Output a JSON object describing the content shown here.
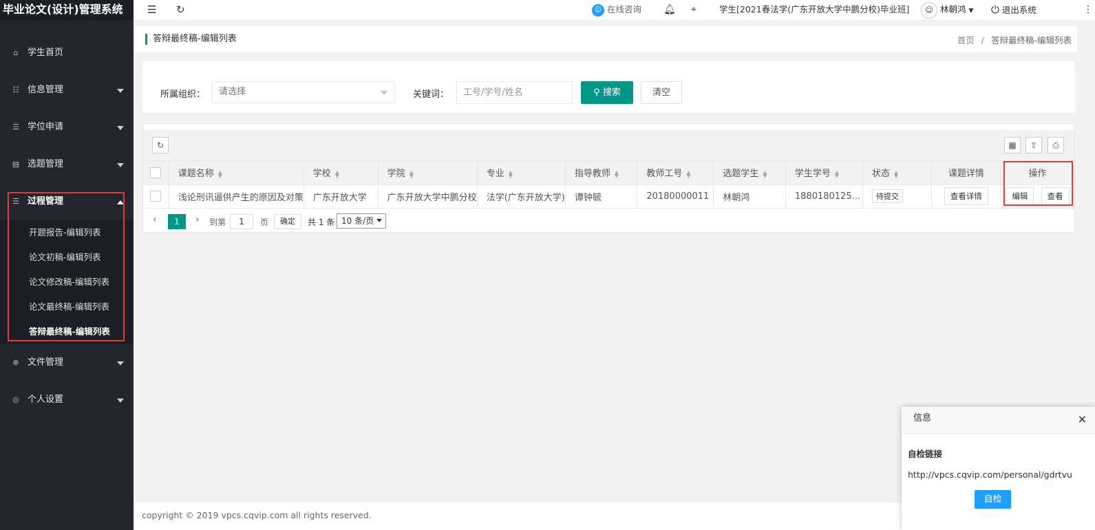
{
  "app": {
    "title": "毕业论文(设计)管理系统"
  },
  "sidebar": {
    "items": [
      {
        "label": "学生首页",
        "icon": "home-icon"
      },
      {
        "label": "信息管理",
        "icon": "list-icon"
      },
      {
        "label": "学位申请",
        "icon": "sliders-icon"
      },
      {
        "label": "选题管理",
        "icon": "document-icon"
      },
      {
        "label": "过程管理",
        "icon": "sliders-icon"
      },
      {
        "label": "文件管理",
        "icon": "download-icon"
      },
      {
        "label": "个人设置",
        "icon": "user-circle-icon"
      }
    ],
    "process_sub": [
      {
        "label": "开题报告-编辑列表"
      },
      {
        "label": "论文初稿-编辑列表"
      },
      {
        "label": "论文修改稿-编辑列表"
      },
      {
        "label": "论文最终稿-编辑列表"
      },
      {
        "label": "答辩最终稿-编辑列表"
      }
    ]
  },
  "topbar": {
    "online": "在线咨询",
    "class_info": "学生[2021春法学(广东开放大学中鹏分校)毕业班]",
    "username": "林朝鸿",
    "logout": "退出系统"
  },
  "page": {
    "title": "答辩最终稿-编辑列表",
    "breadcrumb_home": "首页",
    "breadcrumb_sep": "/",
    "breadcrumb_current": "答辩最终稿-编辑列表"
  },
  "search": {
    "org_label": "所属组织：",
    "org_placeholder": "请选择",
    "keyword_label": "关键词：",
    "keyword_placeholder": "工号/学号/姓名",
    "search_button": "搜索",
    "clear_button": "清空"
  },
  "table": {
    "headers": [
      "课题名称",
      "学校",
      "学院",
      "专业",
      "指导教师",
      "教师工号",
      "选题学生",
      "学生学号",
      "状态",
      "课题详情",
      "操作"
    ],
    "rows": [
      {
        "topic": "浅论刑讯逼供产生的原因及对策",
        "school": "广东开放大学",
        "college": "广东开放大学中鹏分校",
        "major": "法学(广东开放大学)",
        "teacher": "谭钟毓",
        "teacher_id": "20180000011",
        "student": "林朝鸿",
        "student_id": "1880180125...",
        "status": "待提交",
        "detail_button": "查看详情",
        "edit_button": "编辑",
        "view_button": "查看"
      }
    ]
  },
  "pager": {
    "current_page": "1",
    "goto_label": "到第",
    "goto_value": "1",
    "page_unit": "页",
    "confirm": "确定",
    "total": "共 1 条",
    "page_size": "10 条/页"
  },
  "footer": {
    "text": "copyright © 2019 vpcs.cqvip.com all rights reserved."
  },
  "popup": {
    "title": "信息",
    "subtitle": "自检链接",
    "url": "http://vpcs.cqvip.com/personal/gdrtvu",
    "button": "自检"
  },
  "colors": {
    "primary": "#009688",
    "sidebar_bg": "#23262e",
    "popup_button": "#1e9fff",
    "highlight": "#e53935"
  }
}
